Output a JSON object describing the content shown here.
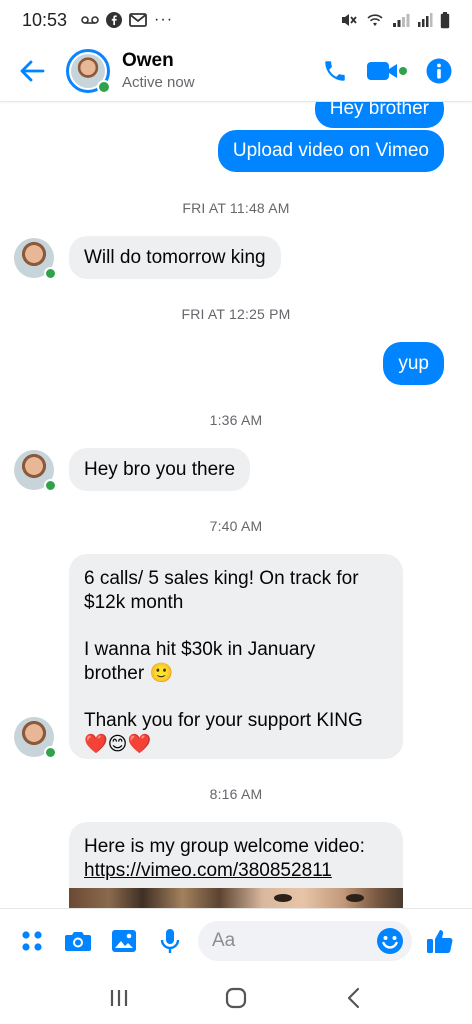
{
  "status_bar": {
    "time": "10:53",
    "more_label": "···",
    "left_icons": [
      "voicemail-icon",
      "facebook-icon",
      "gmail-icon"
    ],
    "right_icons": [
      "mute-icon",
      "wifi-icon",
      "signal-icon",
      "battery-icon"
    ]
  },
  "header": {
    "contact_name": "Owen",
    "contact_status": "Active now",
    "accent_color": "#0084ff",
    "online_color": "#31a24c"
  },
  "messages": {
    "out_1": "Hey brother",
    "out_2": "Upload video on Vimeo",
    "ts_1": "FRI AT 11:48 AM",
    "in_1": "Will do tomorrow king",
    "ts_2": "FRI AT 12:25 PM",
    "out_3": "yup",
    "ts_3": "1:36 AM",
    "in_2": "Hey bro you there",
    "ts_4": "7:40 AM",
    "in_3_line_1": "6 calls/ 5 sales king! On track for",
    "in_3_line_2": "$12k month",
    "in_3_line_3": "I wanna hit $30k in January",
    "in_3_line_4": "brother 🙂",
    "in_3_line_5": "Thank you for your support KING",
    "in_3_line_6": "❤️😊❤️",
    "ts_5": "8:16 AM",
    "in_4_line_1": "Here is my group welcome video:",
    "in_4_link": "https://vimeo.com/380852811"
  },
  "composer": {
    "placeholder": "Aa"
  }
}
